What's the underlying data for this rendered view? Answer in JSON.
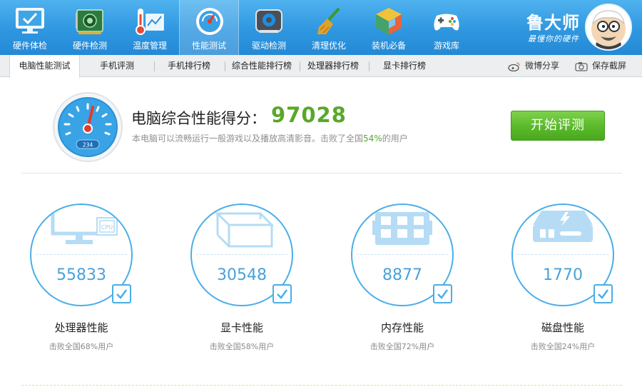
{
  "toolbar": {
    "items": [
      {
        "label": "硬件体检",
        "icon": "monitor-check-icon"
      },
      {
        "label": "硬件检测",
        "icon": "circuit-board-icon"
      },
      {
        "label": "温度管理",
        "icon": "thermometer-icon"
      },
      {
        "label": "性能测试",
        "icon": "speedometer-icon",
        "active": true
      },
      {
        "label": "驱动检测",
        "icon": "driver-gear-icon"
      },
      {
        "label": "清理优化",
        "icon": "broom-icon"
      },
      {
        "label": "装机必备",
        "icon": "cube-box-icon"
      },
      {
        "label": "游戏库",
        "icon": "gamepad-icon"
      }
    ]
  },
  "brand": {
    "name": "鲁大师",
    "slogan": "最懂你的硬件"
  },
  "tabs": [
    {
      "label": "电脑性能测试",
      "active": true
    },
    {
      "label": "手机评测"
    },
    {
      "label": "手机排行榜"
    },
    {
      "label": "综合性能排行榜"
    },
    {
      "label": "处理器排行榜"
    },
    {
      "label": "显卡排行榜"
    }
  ],
  "share": {
    "weibo": "微博分享",
    "screenshot": "保存截屏"
  },
  "score": {
    "title": "电脑综合性能得分：",
    "value": "97028",
    "gauge_reading": "234",
    "desc_prefix": "本电脑可以流畅运行一般游戏以及播放高清影音。击败了全国",
    "desc_pct": "54%",
    "desc_suffix": "的用户"
  },
  "start_button": "开始评测",
  "components": [
    {
      "name": "处理器性能",
      "value": "55833",
      "desc": "击败全国68%用户",
      "icon": "cpu-monitor-icon",
      "chip_label": "CPU"
    },
    {
      "name": "显卡性能",
      "value": "30548",
      "desc": "击败全国58%用户",
      "icon": "graphics-cube-icon"
    },
    {
      "name": "内存性能",
      "value": "8877",
      "desc": "击败全国72%用户",
      "icon": "memory-chip-icon"
    },
    {
      "name": "磁盘性能",
      "value": "1770",
      "desc": "击败全国24%用户",
      "icon": "disk-drive-icon"
    }
  ],
  "colors": {
    "accent": "#2f97e0",
    "score_green": "#58a82a",
    "ring_blue": "#4aaee8"
  }
}
